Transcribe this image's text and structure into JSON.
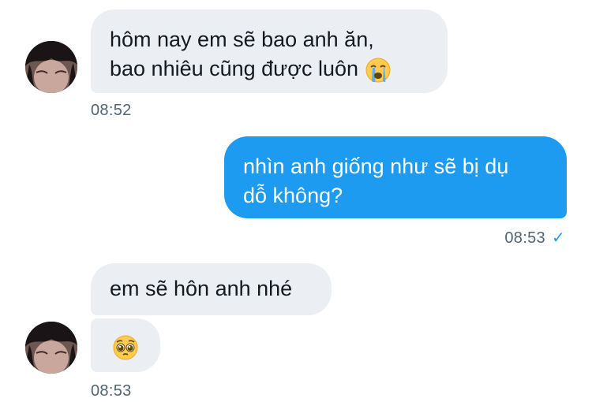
{
  "conversation": {
    "messages": [
      {
        "direction": "incoming",
        "lines": [
          "hôm nay em sẽ bao anh ăn,",
          "bao nhiêu cũng được luôn"
        ],
        "emoji": "loudly-crying-face-icon",
        "time": "08:52"
      },
      {
        "direction": "outgoing",
        "lines": [
          "nhìn anh giống như sẽ bị dụ",
          "dỗ không?"
        ],
        "time": "08:53",
        "status": "✓"
      },
      {
        "direction": "incoming",
        "lines": [
          "em sẽ hôn anh nhé"
        ]
      },
      {
        "direction": "incoming",
        "emoji": "pleading-face-icon",
        "time": "08:53"
      }
    ]
  },
  "colors": {
    "incoming_bubble": "#ebeef2",
    "outgoing_bubble": "#1d9bf0",
    "timestamp": "#536471",
    "read_check": "#1d9bf0"
  }
}
